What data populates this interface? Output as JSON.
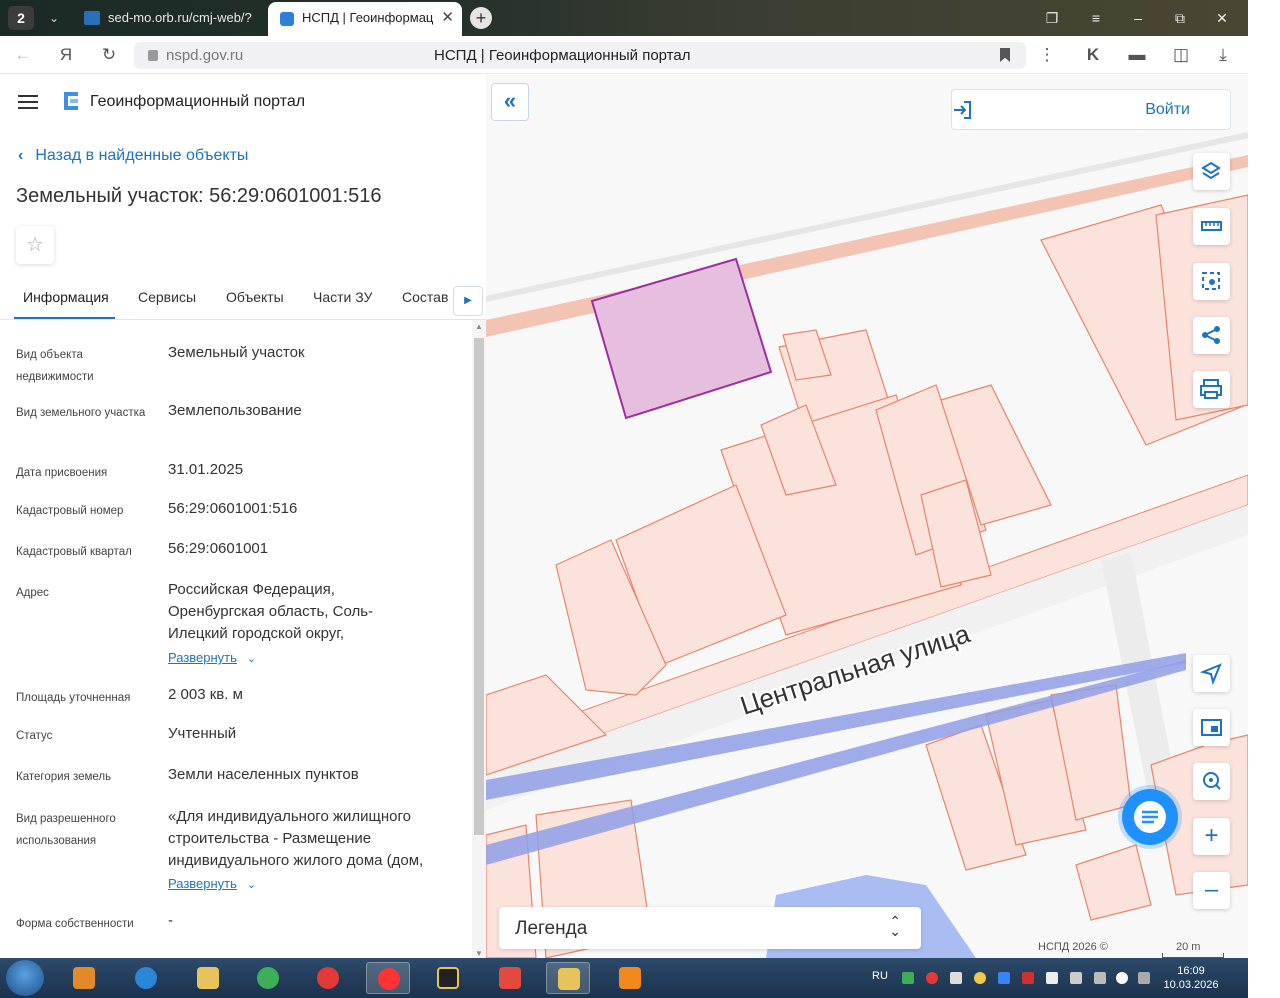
{
  "browser": {
    "tab_count": "2",
    "tabs": [
      {
        "title": "sed-mo.orb.ru/cmj-web/?"
      },
      {
        "title": "НСПД | Геоинформац"
      }
    ],
    "url": "nspd.gov.ru",
    "page_title": "НСПД | Геоинформационный портал"
  },
  "app": {
    "title": "Геоинформационный портал",
    "back_link": "Назад в найденные объекты",
    "object_title": "Земельный участок: 56:29:0601001:516",
    "tabs": [
      "Информация",
      "Сервисы",
      "Объекты",
      "Части ЗУ",
      "Состав"
    ]
  },
  "info": {
    "object_type_label": "Вид объекта недвижимости",
    "object_type": "Земельный участок",
    "parcel_type_label": "Вид земельного участка",
    "parcel_type": "Землепользование",
    "date_label": "Дата присвоения",
    "date": "31.01.2025",
    "cad_number_label": "Кадастровый номер",
    "cad_number": "56:29:0601001:516",
    "cad_quarter_label": "Кадастровый квартал",
    "cad_quarter": "56:29:0601001",
    "address_label": "Адрес",
    "address": "Российская Федерация, Оренбургская область, Соль-Илецкий городской округ,",
    "expand": "Развернуть",
    "area_label": "Площадь уточненная",
    "area": "2 003 кв. м",
    "status_label": "Статус",
    "status": "Учтенный",
    "category_label": "Категория земель",
    "category": "Земли населенных пунктов",
    "use_label": "Вид разрешенного использования",
    "use": "«Для индивидуального жилищного строительства - Размещение индивидуального жилого дома (дом,",
    "ownership_label": "Форма собственности",
    "ownership": "-"
  },
  "map": {
    "login": "Войти",
    "street": "Центральная улица",
    "legend": "Легенда",
    "copyright": "НСПД 2026 ©",
    "scale": "20 m",
    "colors": {
      "parcel_fill": "#fbe3dc",
      "parcel_stroke": "#e8846a",
      "selected_fill": "#e6bede",
      "selected_stroke": "#9b2fa0",
      "road": "#f3c4b3",
      "line": "#8f9fe6",
      "accent": "#1e73be"
    }
  },
  "taskbar": {
    "lang": "RU",
    "time": "16:09",
    "date": "10.03.2026"
  }
}
